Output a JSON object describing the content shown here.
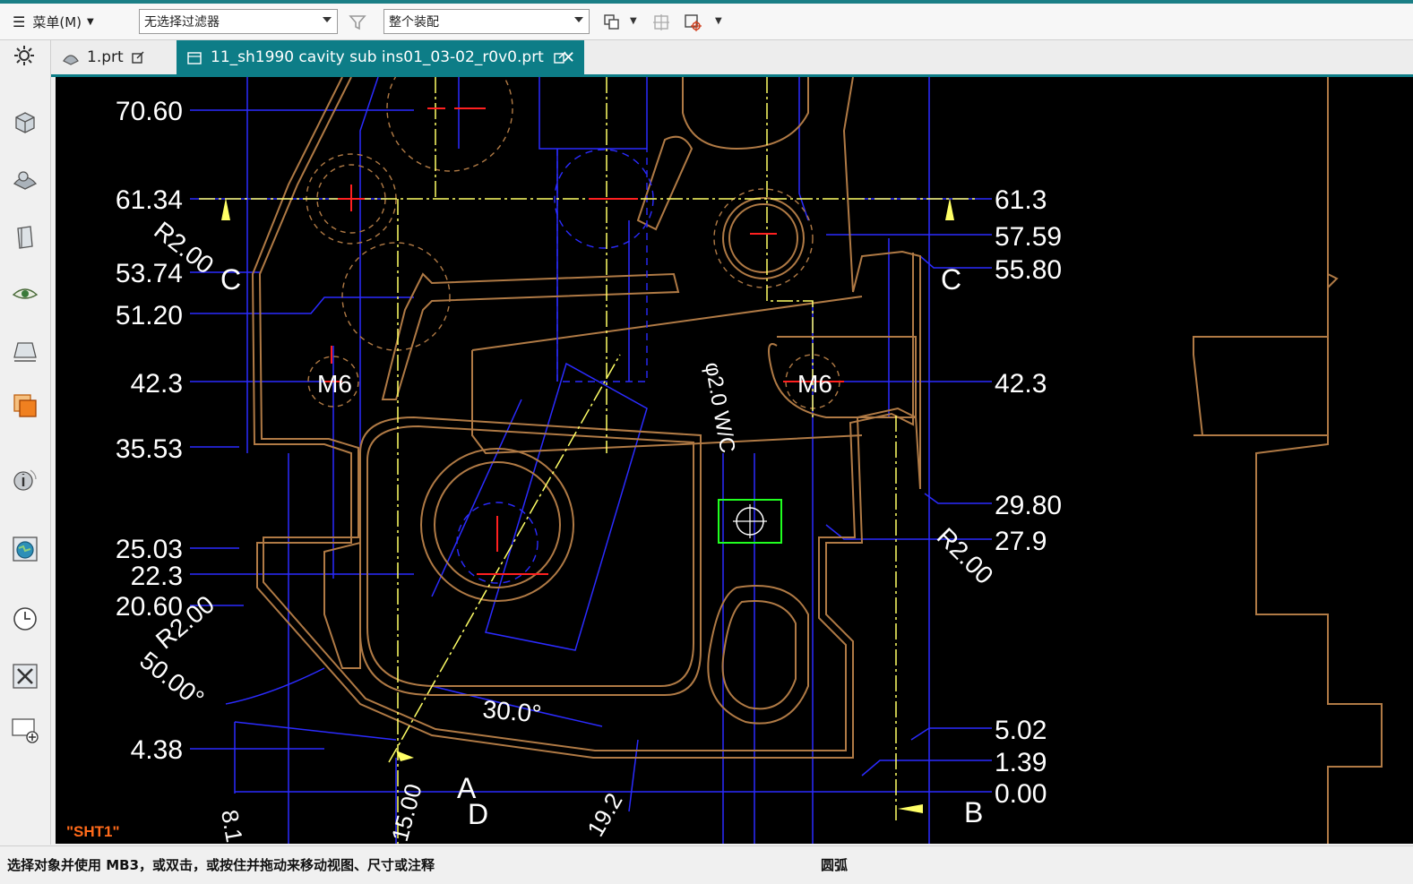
{
  "toolbar": {
    "menu_label": "菜单(M)",
    "filter_select": "无选择过滤器",
    "assembly_select": "整个装配"
  },
  "tabs": [
    {
      "label": "1.prt"
    },
    {
      "label": "11_sh1990 cavity sub ins01_03-02_r0v0.prt"
    }
  ],
  "drawing": {
    "sheet_name": "\"SHT1\"",
    "left_dims": [
      "70.60",
      "61.34",
      "53.74",
      "51.20",
      "42.3",
      "35.53",
      "25.03",
      "22.3",
      "20.60",
      "4.38"
    ],
    "right_dims": [
      "61.3",
      "57.59",
      "55.80",
      "42.3",
      "29.80",
      "27.9",
      "5.02",
      "1.39",
      "0.00"
    ],
    "radius_labels": [
      "R2.00",
      "R2.00",
      "R2.00"
    ],
    "thread_labels": [
      "M6",
      "M6"
    ],
    "section_labels": [
      "C",
      "C",
      "A",
      "D",
      "B"
    ],
    "angle_labels": [
      "50.00°",
      "30.0°"
    ],
    "hole_label": "φ2.0 W/C",
    "bottom_dims": [
      "15.00",
      "19.2",
      "8.1"
    ]
  },
  "status": {
    "prompt": "选择对象并使用 MB3，或双击，或按住并拖动来移动视图、尺寸或注释",
    "selection": "圆弧"
  },
  "colors": {
    "accent": "#0d7d87",
    "geometry": "#b07a45",
    "dimension": "#2b2bff",
    "centerline": "#ffff66"
  }
}
